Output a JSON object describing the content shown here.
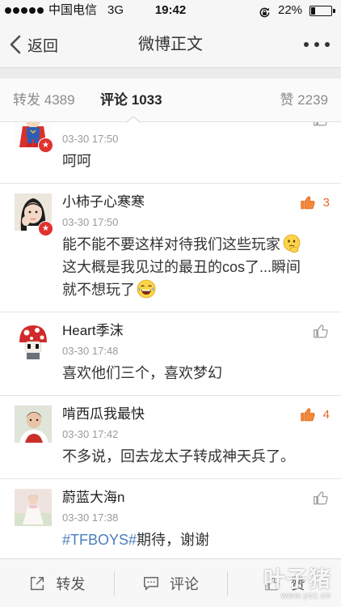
{
  "status_bar": {
    "signal_strength": 5,
    "carrier": "中国电信",
    "network": "3G",
    "time": "19:42",
    "battery_text": "22%",
    "battery_level": 0.22
  },
  "nav": {
    "back_label": "返回",
    "title": "微博正文",
    "back_icon": "chevron-left-icon",
    "more_icon": "more-icon"
  },
  "tabs": {
    "repost": {
      "label": "转发",
      "count": "4389"
    },
    "comments": {
      "label": "评论",
      "count": "1033",
      "active": true
    },
    "likes": {
      "label": "赞",
      "count": "2239"
    }
  },
  "comments": [
    {
      "time": "03-30 17:50",
      "text": "呵呵",
      "badge": true,
      "like_highlighted": false
    },
    {
      "name": "小柿子心寒寒",
      "time": "03-30 17:50",
      "badge": true,
      "like_highlighted": true,
      "like_count": "3",
      "text_lines": [
        "能不能不要这样对待我们这些玩家",
        "这大概是我见过的最丑的cos了...瞬间",
        "就不想玩了"
      ],
      "emoticons": [
        {
          "line": 0,
          "icon": "emoticon-thinking-icon"
        },
        {
          "line": 2,
          "icon": "emoticon-laugh-tears-icon"
        }
      ]
    },
    {
      "name": "Heart季沫",
      "time": "03-30 17:48",
      "badge": false,
      "like_highlighted": false,
      "text": "喜欢他们三个，喜欢梦幻"
    },
    {
      "name": "啃西瓜我最快",
      "time": "03-30 17:42",
      "badge": false,
      "like_highlighted": true,
      "like_count": "4",
      "text": "不多说，回去龙太子转成神天兵了。"
    },
    {
      "name": "蔚蓝大海n",
      "time": "03-30 17:38",
      "badge": false,
      "like_highlighted": false,
      "hashtag": "#TFBOYS#",
      "text": "期待，谢谢"
    }
  ],
  "toolbar": [
    {
      "label": "转发",
      "icon": "share-icon"
    },
    {
      "label": "评论",
      "icon": "comment-icon"
    },
    {
      "label": "赞",
      "icon": "like-icon"
    }
  ],
  "watermark": {
    "brand": "叶子猪",
    "url": "www.yzz.cn"
  },
  "colors": {
    "like_orange": "#f5883a",
    "like_count": "#e4682a",
    "hashtag_blue": "#4a7ebb",
    "badge_red": "#e0322f",
    "bar_background": "#f6f6f6"
  }
}
